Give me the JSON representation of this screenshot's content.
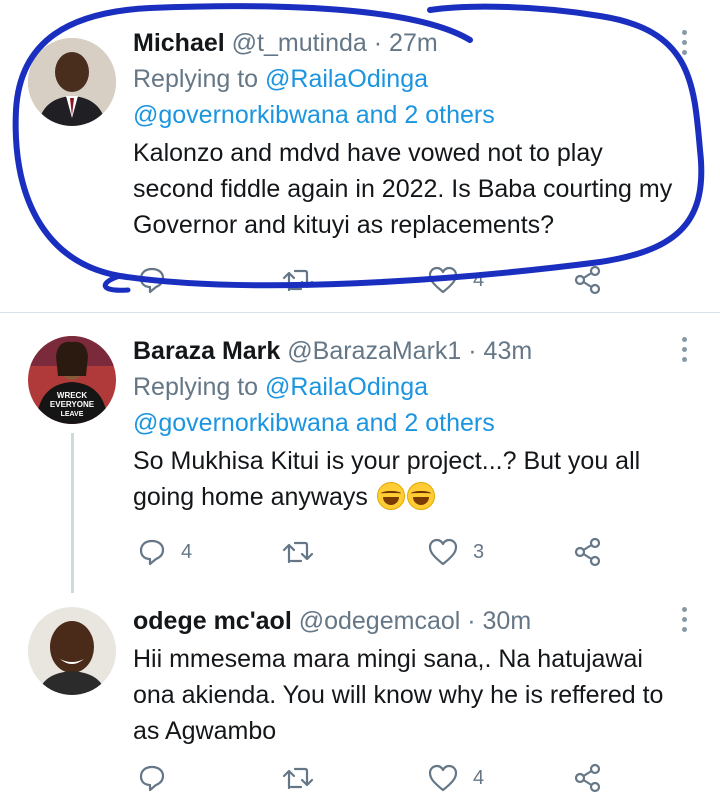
{
  "tweets": [
    {
      "name": "Michael",
      "handle": "@t_mutinda",
      "time": "27m",
      "replying_prefix": "Replying to ",
      "replying_to": "@RailaOdinga",
      "replying_to_2": "@governorkibwana and 2 others",
      "text": "Kalonzo and mdvd have vowed not to play second fiddle again in 2022. Is Baba courting my Governor and kituyi as replacements?",
      "replies": "",
      "retweets": "",
      "likes": "4"
    },
    {
      "name": "Baraza Mark",
      "handle": "@BarazaMark1",
      "time": "43m",
      "replying_prefix": "Replying to ",
      "replying_to": "@RailaOdinga",
      "replying_to_2": "@governorkibwana and 2 others",
      "text": "So Mukhisa Kitui is your project...? But you all going home anyways",
      "replies": "4",
      "retweets": "",
      "likes": "3",
      "avatar_shirt_text": "WRECK EVERYONE LEAVE"
    },
    {
      "name": "odege mc'aol",
      "handle": "@odegemcaol",
      "time": "30m",
      "text": "Hii mmesema mara mingi sana,. Na hatujawai ona akienda. You will know why he is reffered to as Agwambo",
      "replies": "",
      "retweets": "",
      "likes": "4"
    }
  ],
  "separator": " · ",
  "colors": {
    "link": "#1b95e0",
    "muted": "#657786",
    "annotation_ink": "#1a2fbf",
    "divider": "#d9e1e8"
  }
}
